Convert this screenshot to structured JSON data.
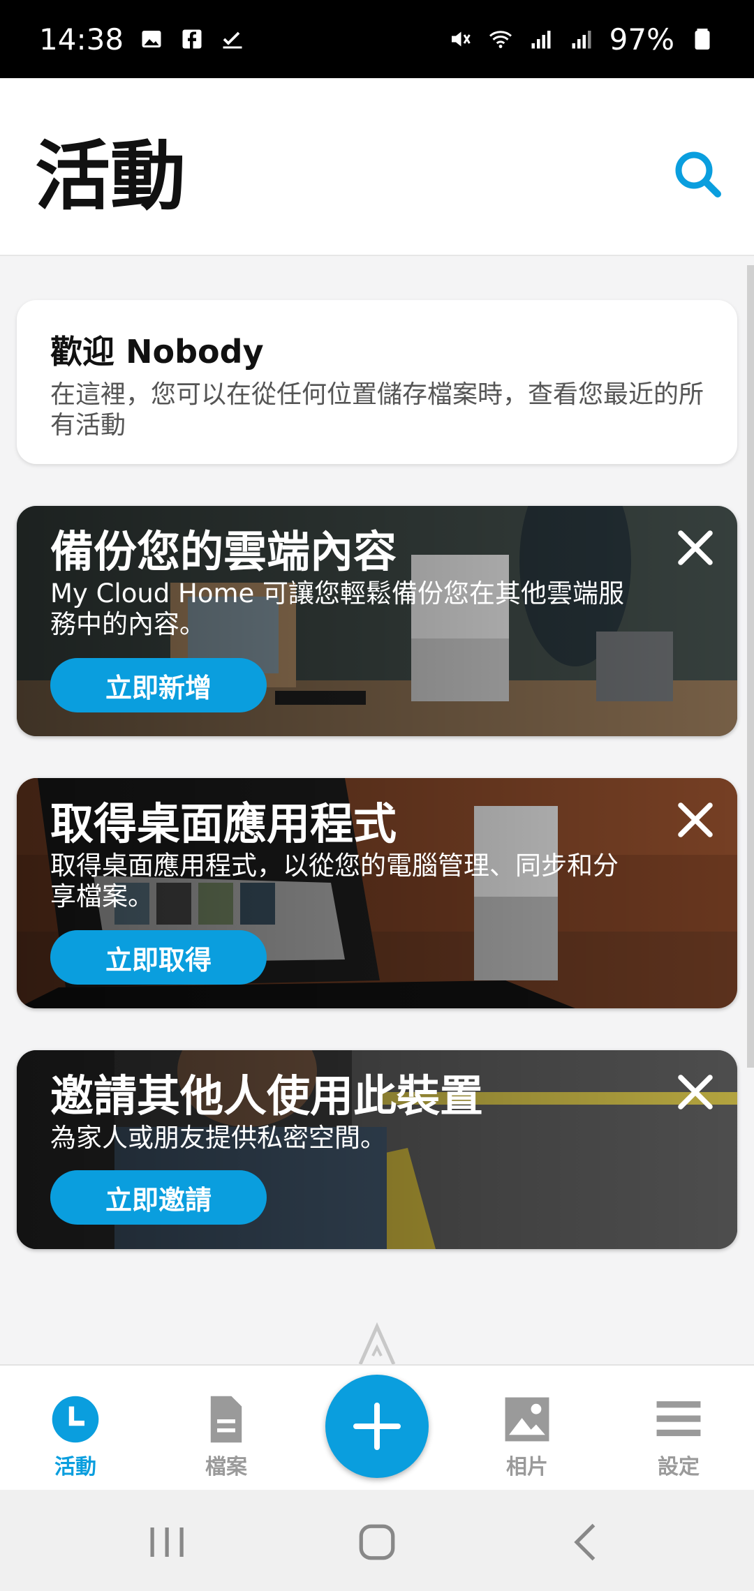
{
  "status_bar": {
    "time": "14:38",
    "battery": "97%",
    "left_icons": [
      "gallery-icon",
      "facebook-icon",
      "check-icon"
    ],
    "right_icons": [
      "mute-icon",
      "wifi-icon",
      "signal-icon",
      "signal-icon",
      "battery-icon"
    ]
  },
  "header": {
    "title": "活動"
  },
  "welcome": {
    "title": "歡迎 Nobody",
    "text": "在這裡，您可以在從任何位置儲存檔案時，查看您最近的所有活動"
  },
  "promos": [
    {
      "title": "備份您的雲端內容",
      "text": "My Cloud Home 可讓您輕鬆備份您在其他雲端服務中的內容。",
      "button": "立即新增"
    },
    {
      "title": "取得桌面應用程式",
      "text": "取得桌面應用程式，以從您的電腦管理、同步和分享檔案。",
      "button": "立即取得"
    },
    {
      "title": "邀請其他人使用此裝置",
      "text": "為家人或朋友提供私密空間。",
      "button": "立即邀請"
    }
  ],
  "bottom_nav": {
    "items": [
      {
        "label": "活動",
        "icon": "clock-icon"
      },
      {
        "label": "檔案",
        "icon": "file-icon"
      },
      {
        "label": "相片",
        "icon": "image-icon"
      },
      {
        "label": "設定",
        "icon": "menu-icon"
      }
    ],
    "fab_icon": "plus-icon"
  },
  "colors": {
    "accent": "#0a9ede",
    "inactive": "#9a9a9a"
  }
}
